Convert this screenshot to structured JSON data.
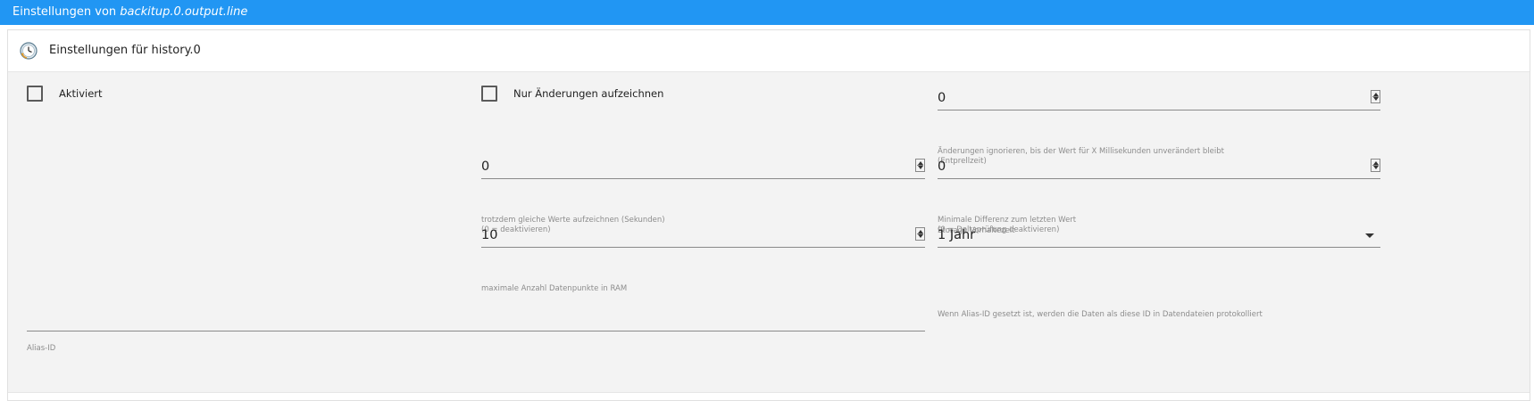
{
  "dialog": {
    "title_prefix": "Einstellungen von ",
    "title_object": "backitup.0.output.line"
  },
  "panel": {
    "title": "Einstellungen für history.0",
    "icon": "history-clock-icon"
  },
  "settings": {
    "enabled": {
      "label": "Aktiviert",
      "checked": false
    },
    "changes_only": {
      "label": "Nur Änderungen aufzeichnen",
      "checked": false
    },
    "debounce": {
      "value": "0",
      "help_line1": "Änderungen ignorieren, bis der Wert für X Millisekunden unverändert bleibt",
      "help_line2": "(Entprellzeit)"
    },
    "same_values": {
      "value": "0",
      "help_line1": "trotzdem gleiche Werte aufzeichnen (Sekunden)",
      "help_line2": "(0 = deaktivieren)"
    },
    "min_diff": {
      "value": "0",
      "help_line1": "Minimale Differenz zum letzten Wert",
      "help_line2": "(0 = Deltaprüfung deaktivieren)"
    },
    "max_points": {
      "value": "10",
      "help": "maximale Anzahl Datenpunkte in RAM"
    },
    "retention": {
      "label": "Storage Vorhaltezeit",
      "value": "1 Jahr"
    },
    "alias": {
      "value": "",
      "label": "Alias-ID",
      "help": "Wenn Alias-ID gesetzt ist, werden die Daten als diese ID in Datendateien protokolliert"
    }
  }
}
